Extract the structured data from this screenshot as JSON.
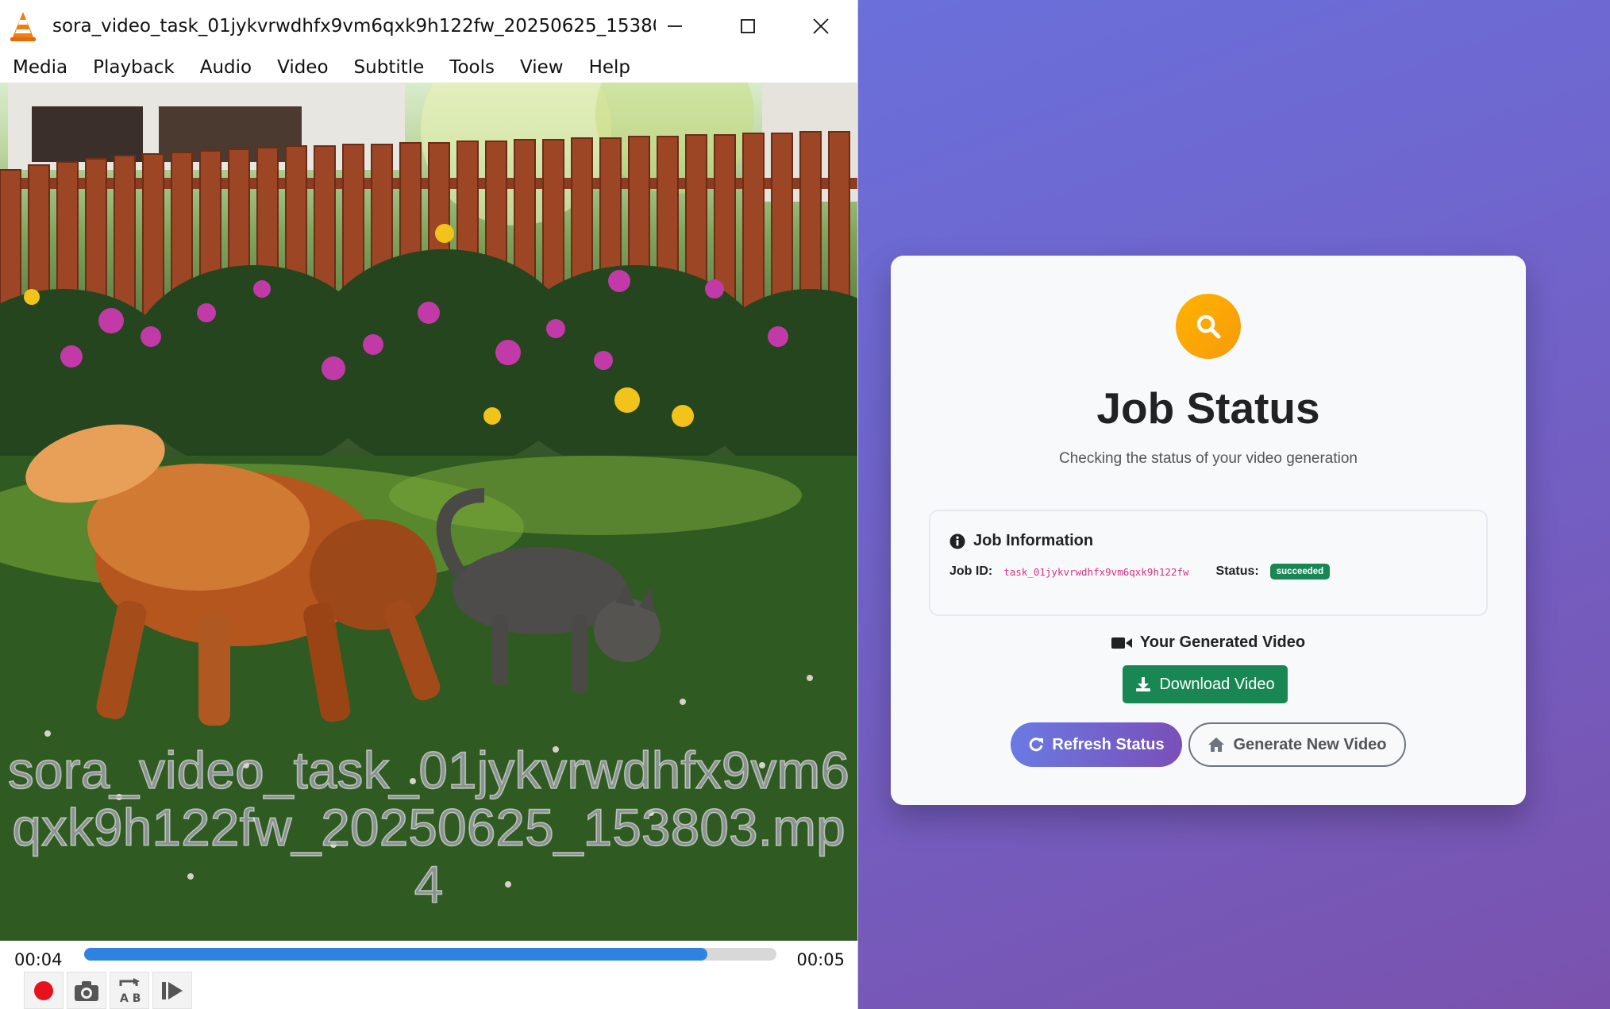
{
  "vlc": {
    "window_title": "sora_video_task_01jykvrwdhfx9vm6qxk9h122fw_20250625_153803.m...",
    "menu": [
      "Media",
      "Playback",
      "Audio",
      "Video",
      "Subtitle",
      "Tools",
      "View",
      "Help"
    ],
    "video_overlay_title": "sora_video_task_01jykvrwdhfx9vm6qxk9h122fw_20250625_153803.mp4",
    "time_elapsed": "00:04",
    "time_total": "00:05",
    "progress_fraction": 0.9,
    "control_buttons": [
      "record-icon",
      "snapshot-icon",
      "loop-ab-icon",
      "frame-step-icon"
    ]
  },
  "page": {
    "title": "Job Status",
    "subtitle": "Checking the status of your video generation",
    "info": {
      "heading": "Job Information",
      "job_id_label": "Job ID:",
      "job_id": "task_01jykvrwdhfx9vm6qxk9h122fw",
      "status_label": "Status:",
      "status": "succeeded"
    },
    "video_heading": "Your Generated Video",
    "download_label": "Download Video",
    "refresh_label": "Refresh Status",
    "generate_label": "Generate New Video"
  },
  "colors": {
    "background_start": "#6777e2",
    "background_end": "#7a52ad",
    "status_icon": "#ffa90a",
    "success": "#198754",
    "job_id_text": "#d63384",
    "seek_fill": "#2f83e0"
  }
}
